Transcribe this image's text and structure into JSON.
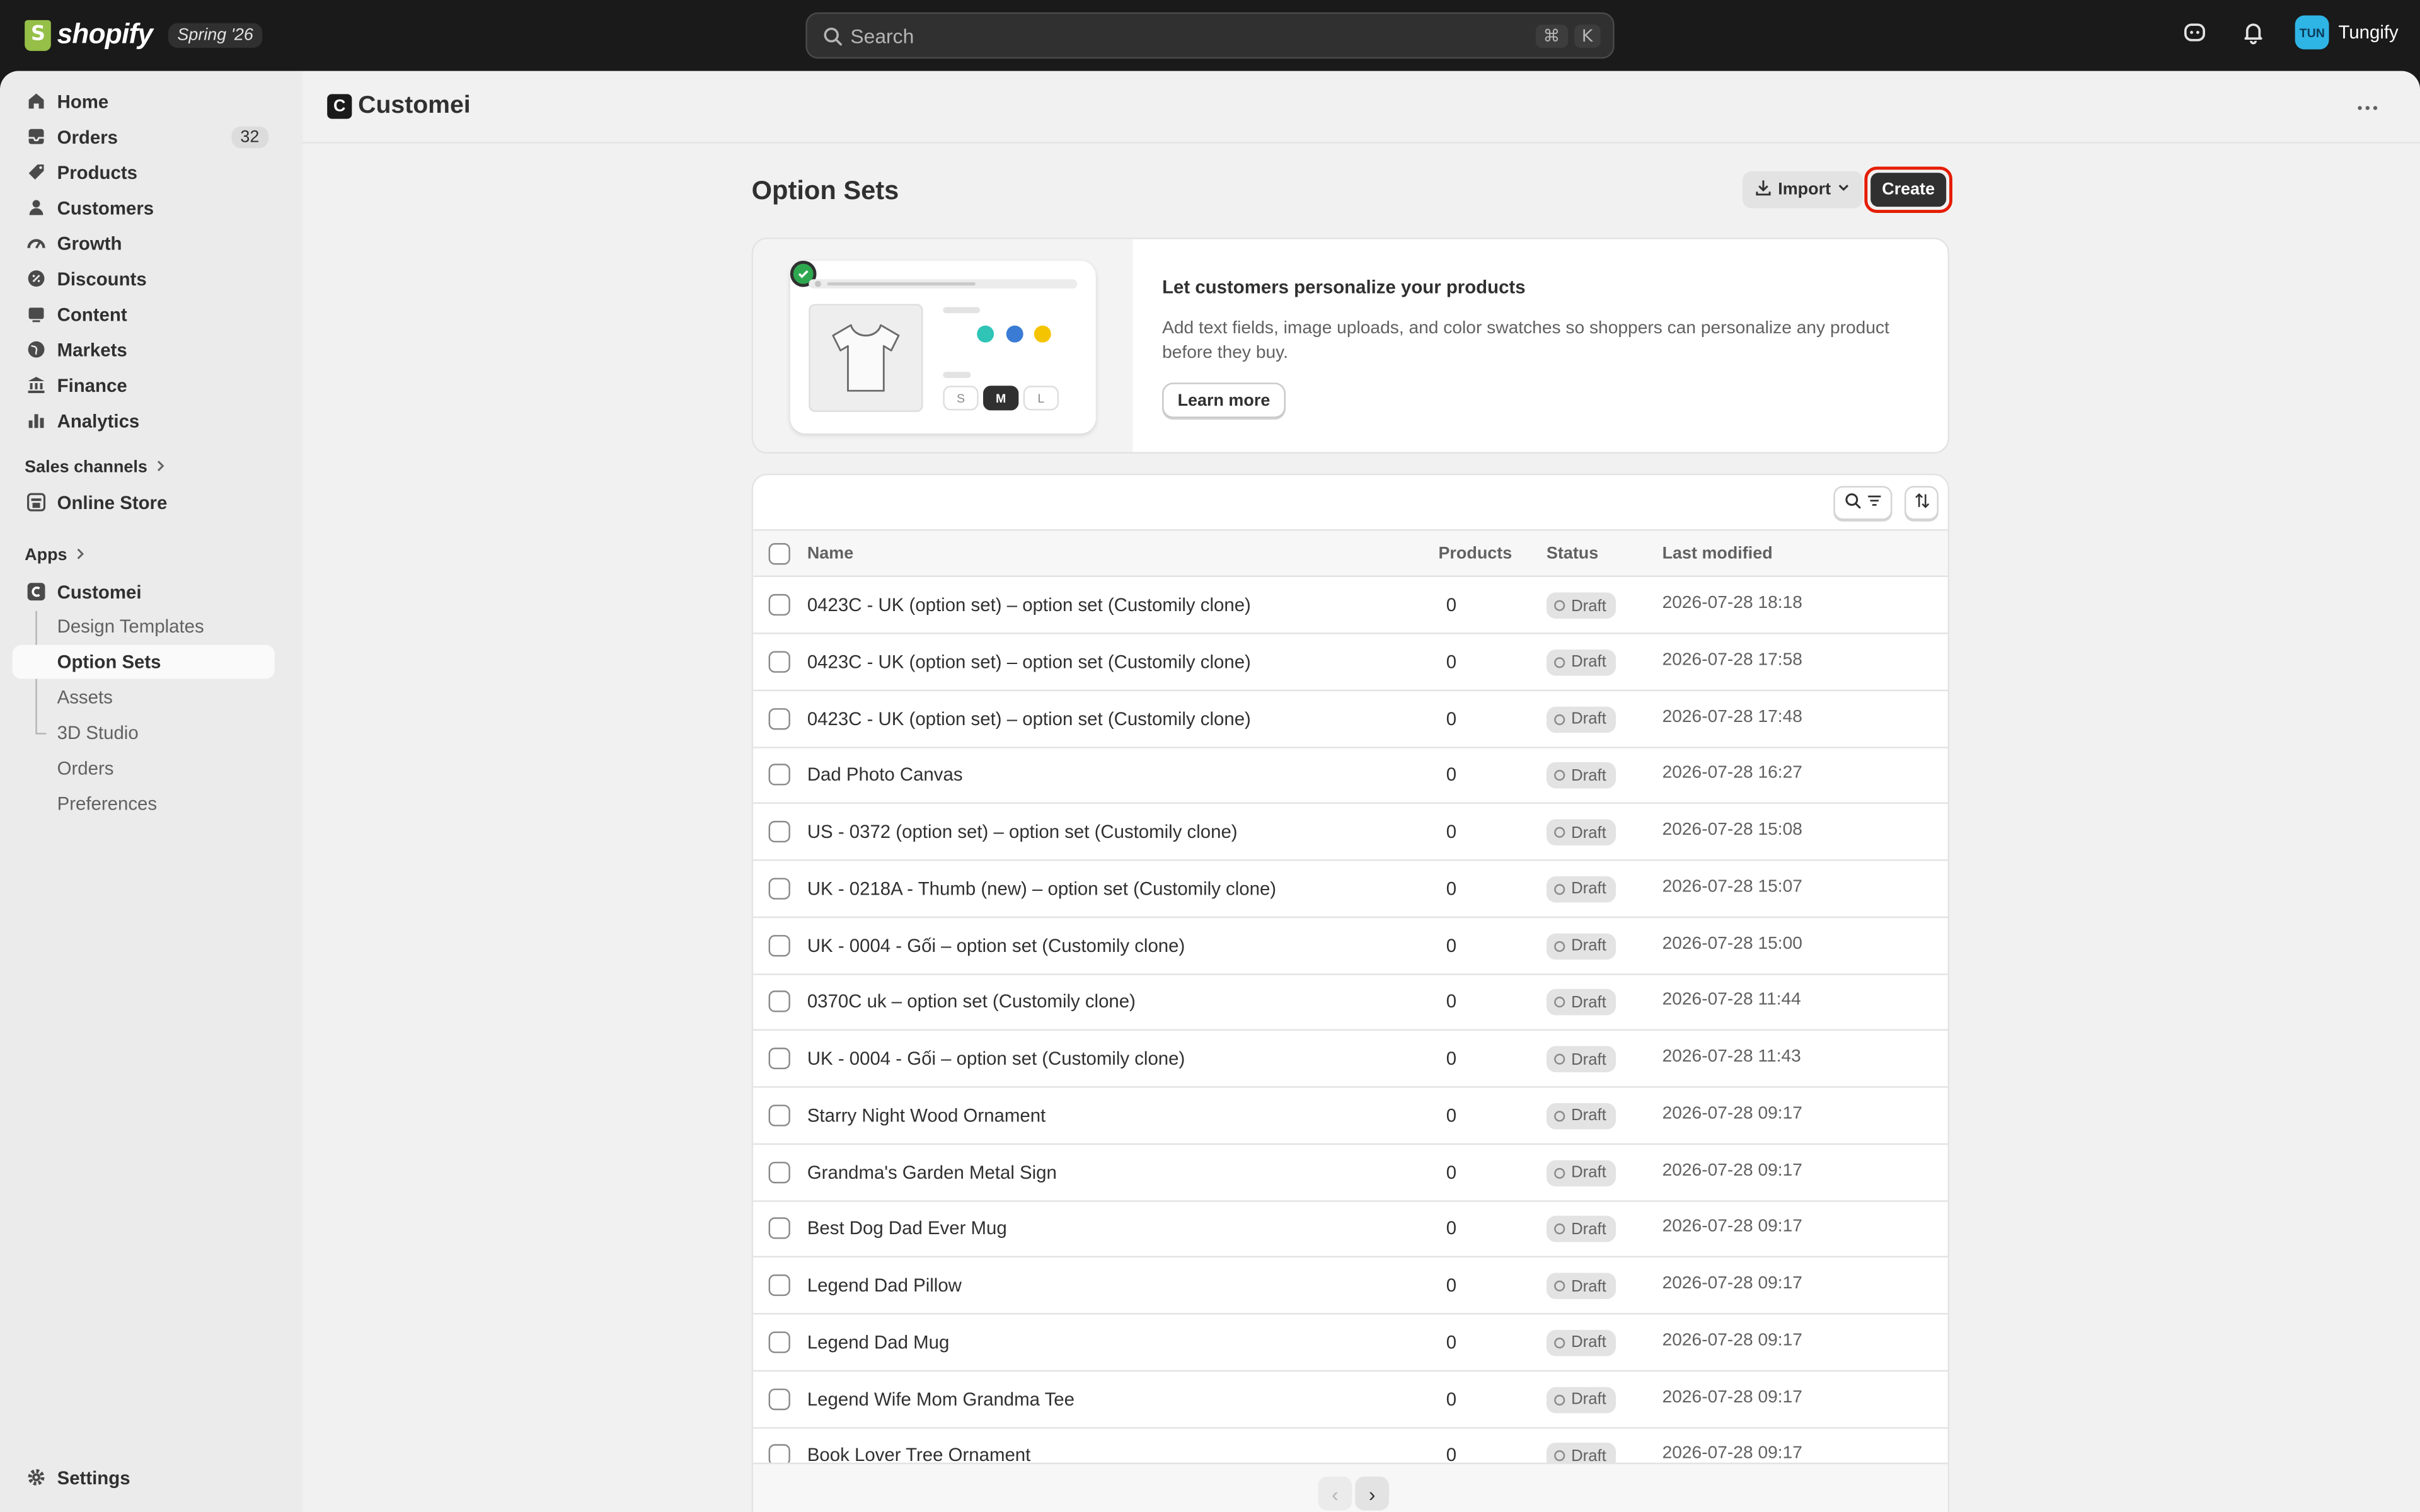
{
  "topbar": {
    "logo_text": "shopify",
    "edition_badge": "Spring '26",
    "search_placeholder": "Search",
    "shortcut_cmd": "⌘",
    "shortcut_key": "K",
    "user_initials": "TUN",
    "user_name": "Tungify"
  },
  "sidebar": {
    "nav": [
      {
        "label": "Home",
        "icon": "home-icon"
      },
      {
        "label": "Orders",
        "icon": "orders-icon",
        "count": "32"
      },
      {
        "label": "Products",
        "icon": "tag-icon"
      },
      {
        "label": "Customers",
        "icon": "person-icon"
      },
      {
        "label": "Growth",
        "icon": "growth-icon"
      },
      {
        "label": "Discounts",
        "icon": "discount-icon"
      },
      {
        "label": "Content",
        "icon": "content-icon"
      },
      {
        "label": "Markets",
        "icon": "globe-icon"
      },
      {
        "label": "Finance",
        "icon": "bank-icon"
      },
      {
        "label": "Analytics",
        "icon": "bar-chart-icon"
      }
    ],
    "sales_channels_label": "Sales channels",
    "online_store_label": "Online Store",
    "apps_label": "Apps",
    "app_name": "Customei",
    "app_sub_items": [
      "Design Templates",
      "Option Sets",
      "Assets",
      "3D Studio",
      "Orders",
      "Preferences"
    ],
    "settings_label": "Settings"
  },
  "main": {
    "app_header_title": "Customei",
    "app_logo_letter": "C",
    "page_title": "Option Sets",
    "import_label": "Import",
    "create_label": "Create",
    "promo": {
      "title": "Let customers personalize your products",
      "body": "Add text fields, image uploads, and color swatches so shoppers can personalize any product before they buy.",
      "learn_more": "Learn more",
      "sizes": [
        "S",
        "M",
        "L"
      ],
      "swatch_colors": [
        "#2ea84f",
        "#2ec4b6",
        "#3a7bd5",
        "#f5c400"
      ]
    },
    "table": {
      "columns": {
        "name": "Name",
        "products": "Products",
        "status": "Status",
        "modified": "Last modified"
      },
      "rows": [
        {
          "name": "0423C - UK (option set) – option set (Customily clone)",
          "products": "0",
          "status": "Draft",
          "modified": "2026-07-28 18:18"
        },
        {
          "name": "0423C - UK (option set) – option set (Customily clone)",
          "products": "0",
          "status": "Draft",
          "modified": "2026-07-28 17:58"
        },
        {
          "name": "0423C - UK (option set) – option set (Customily clone)",
          "products": "0",
          "status": "Draft",
          "modified": "2026-07-28 17:48"
        },
        {
          "name": "Dad Photo Canvas",
          "products": "0",
          "status": "Draft",
          "modified": "2026-07-28 16:27"
        },
        {
          "name": "US - 0372 (option set) – option set (Customily clone)",
          "products": "0",
          "status": "Draft",
          "modified": "2026-07-28 15:08"
        },
        {
          "name": "UK - 0218A - Thumb (new) – option set (Customily clone)",
          "products": "0",
          "status": "Draft",
          "modified": "2026-07-28 15:07"
        },
        {
          "name": "UK - 0004 - Gối – option set (Customily clone)",
          "products": "0",
          "status": "Draft",
          "modified": "2026-07-28 15:00"
        },
        {
          "name": "0370C uk – option set (Customily clone)",
          "products": "0",
          "status": "Draft",
          "modified": "2026-07-28 11:44"
        },
        {
          "name": "UK - 0004 - Gối – option set (Customily clone)",
          "products": "0",
          "status": "Draft",
          "modified": "2026-07-28 11:43"
        },
        {
          "name": "Starry Night Wood Ornament",
          "products": "0",
          "status": "Draft",
          "modified": "2026-07-28 09:17"
        },
        {
          "name": "Grandma's Garden Metal Sign",
          "products": "0",
          "status": "Draft",
          "modified": "2026-07-28 09:17"
        },
        {
          "name": "Best Dog Dad Ever Mug",
          "products": "0",
          "status": "Draft",
          "modified": "2026-07-28 09:17"
        },
        {
          "name": "Legend Dad Pillow",
          "products": "0",
          "status": "Draft",
          "modified": "2026-07-28 09:17"
        },
        {
          "name": "Legend Dad Mug",
          "products": "0",
          "status": "Draft",
          "modified": "2026-07-28 09:17"
        },
        {
          "name": "Legend Wife Mom Grandma Tee",
          "products": "0",
          "status": "Draft",
          "modified": "2026-07-28 09:17"
        },
        {
          "name": "Book Lover Tree Ornament",
          "products": "0",
          "status": "Draft",
          "modified": "2026-07-28 09:17"
        }
      ]
    }
  },
  "colors": {
    "topbar_bg": "#1a1a1a",
    "sidebar_bg": "#ebebeb",
    "main_bg": "#f1f1f1",
    "create_button": "#303030",
    "highlight_ring": "#e51c00",
    "shopify_green": "#95bf47"
  }
}
